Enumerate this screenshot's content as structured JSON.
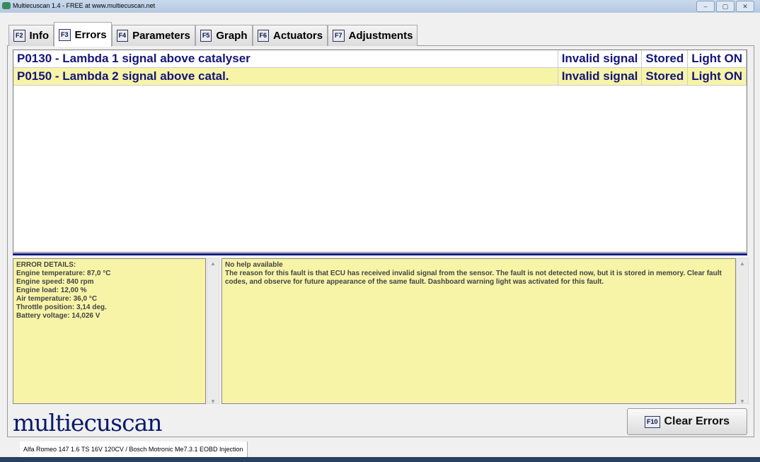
{
  "window": {
    "title": "Multiecuscan 1.4 - FREE at www.multiecuscan.net",
    "controls": [
      "‒",
      "▢",
      "✕"
    ]
  },
  "tabs": [
    {
      "key": "F2",
      "label": "Info"
    },
    {
      "key": "F3",
      "label": "Errors",
      "active": true
    },
    {
      "key": "F4",
      "label": "Parameters"
    },
    {
      "key": "F5",
      "label": "Graph"
    },
    {
      "key": "F6",
      "label": "Actuators"
    },
    {
      "key": "F7",
      "label": "Adjustments"
    }
  ],
  "errors": [
    {
      "code": "P0130 - Lambda 1 signal above catalyser",
      "type": "Invalid signal",
      "status": "Stored",
      "light": "Light ON"
    },
    {
      "code": "P0150 - Lambda 2 signal above catal.",
      "type": "Invalid signal",
      "status": "Stored",
      "light": "Light ON"
    }
  ],
  "details": {
    "title": "ERROR DETAILS:",
    "lines": [
      "Engine temperature: 87,0 °C",
      "Engine speed: 840 rpm",
      "Engine load: 12,00 %",
      "Air temperature: 36,0 °C",
      "Throttle position: 3,14 deg.",
      "Battery voltage: 14,026 V"
    ]
  },
  "help": {
    "title": "No help available",
    "text": "The reason for this fault is that ECU has received invalid signal from the sensor. The fault is not detected now, but it is stored in memory. Clear fault codes, and observe for future appearance of the same fault. Dashboard warning light was activated for this fault."
  },
  "logo": "multiecuscan",
  "clear_button": {
    "key": "F10",
    "label": "Clear Errors"
  },
  "status_bar": "Alfa Romeo 147 1.6 TS 16V 120CV / Bosch Motronic Me7.3.1 EOBD Injection"
}
